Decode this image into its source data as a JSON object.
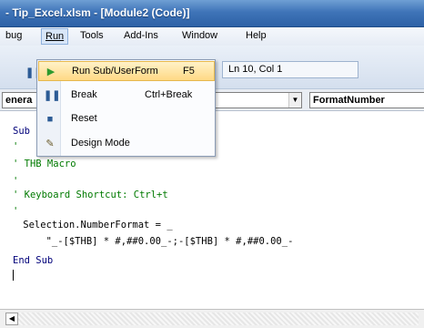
{
  "window": {
    "title": "- Tip_Excel.xlsm - [Module2 (Code)]"
  },
  "menubar": {
    "items": [
      {
        "label": "bug"
      },
      {
        "label": "Run"
      },
      {
        "label": "Tools"
      },
      {
        "label": "Add-Ins"
      },
      {
        "label": "Window"
      },
      {
        "label": "Help"
      }
    ]
  },
  "toolbar": {
    "position_text": "Ln 10, Col 1"
  },
  "combos": {
    "object": "enera",
    "procedure": "FormatNumber"
  },
  "run_menu": {
    "items": [
      {
        "label": "Run Sub/UserForm",
        "shortcut": "F5",
        "icon": "play-icon"
      },
      {
        "label": "Break",
        "shortcut": "Ctrl+Break",
        "icon": "pause-icon"
      },
      {
        "label": "Reset",
        "shortcut": "",
        "icon": "stop-icon"
      },
      {
        "label": "Design Mode",
        "shortcut": "",
        "icon": "design-mode-icon"
      }
    ]
  },
  "code": {
    "lines": [
      "Sub",
      "'",
      "' THB Macro",
      "'",
      "' Keyboard Shortcut: Ctrl+t",
      "'",
      "    Selection.NumberFormat = _",
      "        \"_-[$THB] * #,##0.00_-;-[$THB] * #,##0.00_-",
      "End Sub"
    ]
  }
}
